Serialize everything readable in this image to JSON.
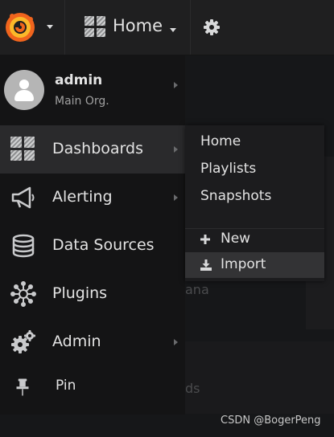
{
  "navbar": {
    "logo_icon": "grafana-logo-icon",
    "dashboard_title": "Home",
    "settings_icon": "gear-icon"
  },
  "user": {
    "name": "admin",
    "org": "Main Org."
  },
  "sidemenu": {
    "items": [
      {
        "label": "Dashboards",
        "icon": "dashboards-grid-icon",
        "active": true
      },
      {
        "label": "Alerting",
        "icon": "megaphone-icon"
      },
      {
        "label": "Data Sources",
        "icon": "database-icon"
      },
      {
        "label": "Plugins",
        "icon": "plugins-icon"
      },
      {
        "label": "Admin",
        "icon": "gears-icon"
      },
      {
        "label": "Pin",
        "icon": "pin-icon"
      }
    ]
  },
  "submenu": {
    "items": [
      "Home",
      "Playlists",
      "Snapshots"
    ],
    "actions": [
      {
        "label": "New",
        "icon": "plus-icon"
      },
      {
        "label": "Import",
        "icon": "import-icon",
        "highlighted": true
      }
    ]
  },
  "background": {
    "ghost_text_1": "ana",
    "ghost_text_2": "ds"
  },
  "watermark": "CSDN @BogerPeng",
  "colors": {
    "logo_orange": "#f0641d",
    "logo_yellow": "#fbb829",
    "background": "#161719",
    "menu_bg": "#141415"
  }
}
